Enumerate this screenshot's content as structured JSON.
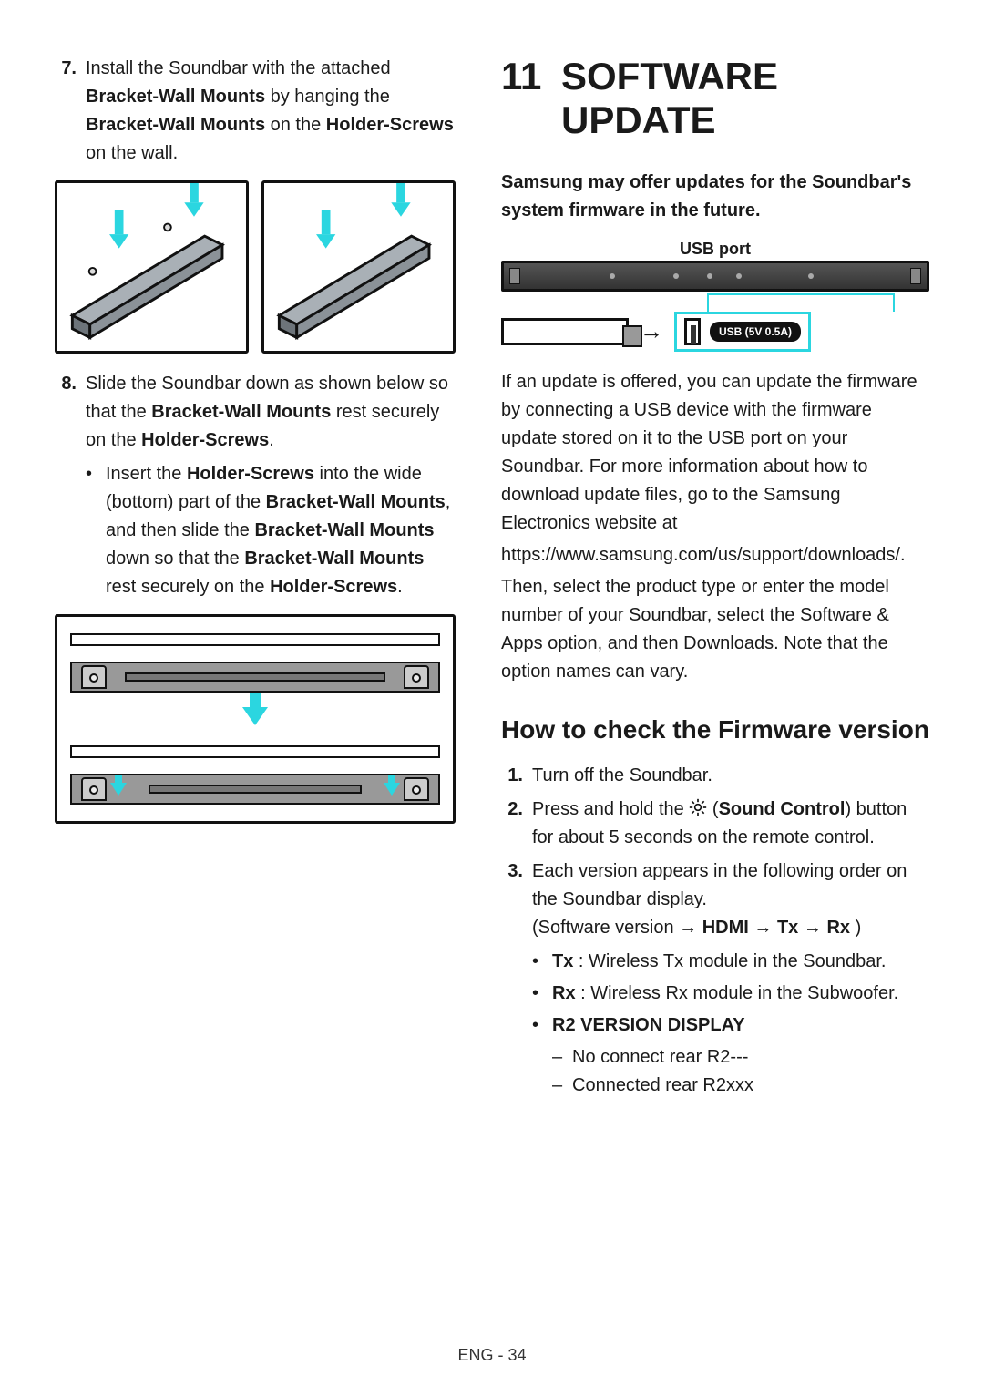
{
  "left": {
    "step7": {
      "num": "7.",
      "text_parts": [
        "Install the Soundbar with the attached ",
        "Bracket-Wall Mounts",
        " by hanging the ",
        "Bracket-Wall Mounts",
        " on the ",
        "Holder-Screws",
        " on the wall."
      ]
    },
    "step8": {
      "num": "8.",
      "text_parts": [
        "Slide the Soundbar down as shown below so that the ",
        "Bracket-Wall Mounts",
        " rest securely on the ",
        "Holder-Screws",
        "."
      ],
      "bullet": {
        "parts": [
          "Insert the ",
          "Holder-Screws",
          " into the wide (bottom) part of the ",
          "Bracket-Wall Mounts",
          ", and then slide the ",
          "Bracket-Wall Mounts",
          " down so that the ",
          "Bracket-Wall Mounts",
          " rest securely on the ",
          "Holder-Screws",
          "."
        ]
      }
    }
  },
  "right": {
    "section_number": "11",
    "section_title": "SOFTWARE UPDATE",
    "lead": "Samsung may offer updates for the Soundbar's system firmware in the future.",
    "usb_port_label": "USB port",
    "usb_badge": "USB (5V 0.5A)",
    "para1": "If an update is offered, you can update the firmware by connecting a USB device with the firmware update stored on it to the USB port on your Soundbar. For more information about how to download update files, go to the Samsung Electronics website at",
    "url": "https://www.samsung.com/us/support/downloads/.",
    "para2": "Then, select the product type or enter the model number of your Soundbar, select the Software & Apps option, and then Downloads. Note that the option names can vary.",
    "subhead": "How to check the Firmware version",
    "fw_steps": {
      "s1": {
        "num": "1.",
        "text": "Turn off the Soundbar."
      },
      "s2": {
        "num": "2.",
        "parts_before_icon": "Press and hold the ",
        "sound_control_label": "Sound Control",
        "parts_after": " button for about 5 seconds on the remote control."
      },
      "s3": {
        "num": "3.",
        "line1": "Each version appears in the following order on the Soundbar display.",
        "line2_prefix": "(Software version ",
        "line2_tokens": [
          "HDMI",
          "Tx",
          "Rx"
        ],
        "line2_suffix": " )",
        "arrow": "→",
        "bullets": [
          {
            "bold": "Tx",
            "rest": " : Wireless Tx module in the Soundbar."
          },
          {
            "bold": "Rx",
            "rest": " : Wireless Rx module in the Subwoofer."
          },
          {
            "bold": "R2 VERSION DISPLAY",
            "rest": ""
          }
        ],
        "dashes": [
          "No connect rear R2---",
          "Connected rear R2xxx"
        ]
      }
    }
  },
  "footer": "ENG - 34"
}
